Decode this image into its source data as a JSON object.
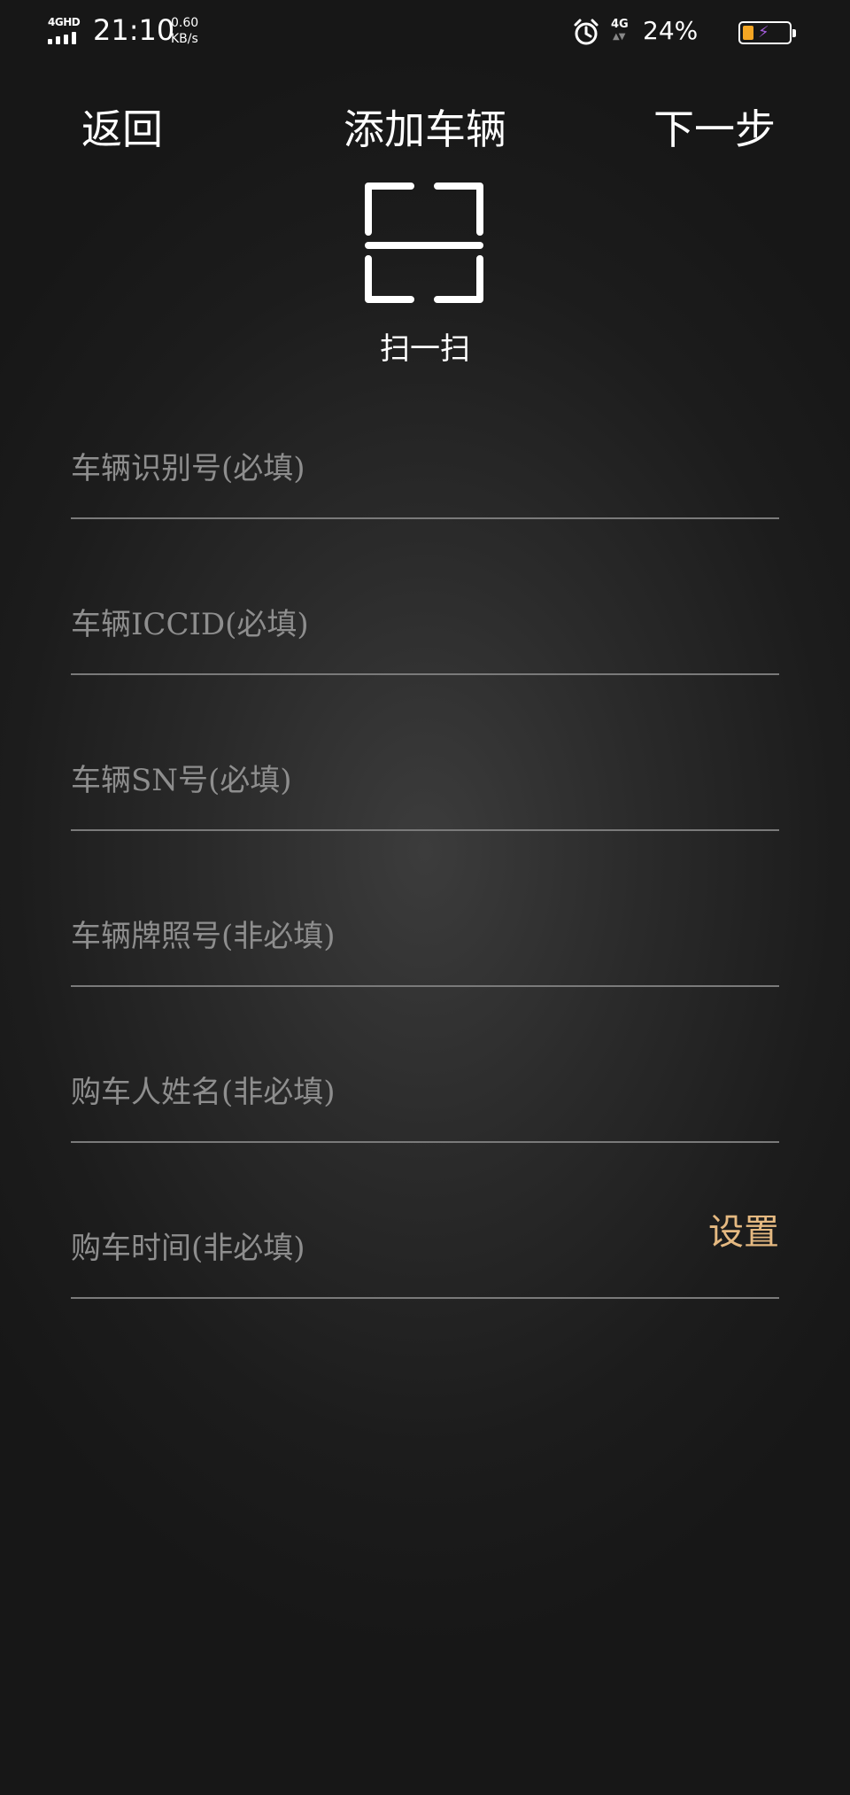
{
  "status_bar": {
    "network_label": "4GHD",
    "time": "21:10",
    "speed_value": "0.60",
    "speed_unit": "KB/s",
    "cell_label": "4G",
    "battery_percent": "24%",
    "battery_level": 0.24,
    "icons": [
      "alarm-icon",
      "battery-icon",
      "charging-icon"
    ]
  },
  "nav": {
    "back_label": "返回",
    "title": "添加车辆",
    "next_label": "下一步"
  },
  "scan": {
    "icon": "scan-icon",
    "label": "扫一扫"
  },
  "form": {
    "fields": [
      {
        "placeholder": "车辆识别号(必填)",
        "value": ""
      },
      {
        "placeholder": "车辆ICCID(必填)",
        "value": ""
      },
      {
        "placeholder": "车辆SN号(必填)",
        "value": ""
      },
      {
        "placeholder": "车辆牌照号(非必填)",
        "value": ""
      },
      {
        "placeholder": "购车人姓名(非必填)",
        "value": ""
      },
      {
        "placeholder": "购车时间(非必填)",
        "value": "",
        "action_label": "设置"
      }
    ]
  },
  "colors": {
    "background": "#1a1a1a",
    "text": "#ffffff",
    "placeholder": "#8e8e8e",
    "divider": "#7a7a7a",
    "accent": "#e5b981",
    "battery_fill": "#f5a623"
  }
}
